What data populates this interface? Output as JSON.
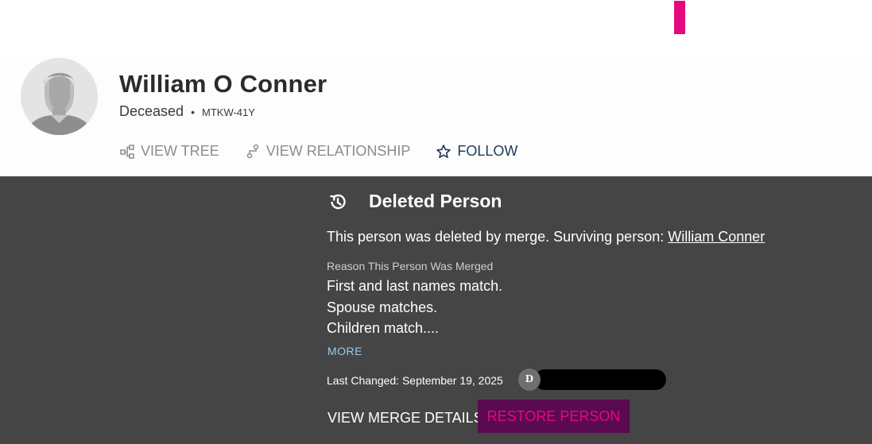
{
  "person": {
    "name": "William O Conner",
    "status": "Deceased",
    "separator": "•",
    "id": "MTKW-41Y"
  },
  "actions": {
    "view_tree": "VIEW TREE",
    "view_relationship": "VIEW RELATIONSHIP",
    "follow": "FOLLOW"
  },
  "deleted_panel": {
    "title": "Deleted Person",
    "merge_message": "This person was deleted by merge. Surviving person: ",
    "surviving_person": "William Conner",
    "reason_label": "Reason This Person Was Merged",
    "reason_lines": [
      "First and last names match.",
      "Spouse matches.",
      "Children match...."
    ],
    "more_label": "MORE",
    "last_changed": "Last Changed: September 19, 2025",
    "contributor_initial": "D",
    "view_merge_details": "VIEW MERGE DETAILS",
    "restore_person": "RESTORE PERSON"
  },
  "icons": {
    "view_tree": "tree-icon",
    "view_relationship": "relationship-icon",
    "follow": "star-outline-icon",
    "deleted": "history-icon",
    "avatar": "person-silhouette"
  },
  "colors": {
    "panel_background": "#454546",
    "accent_pink": "#e5097f",
    "restore_button_background": "#5a0a4f",
    "restore_button_text": "#e5097f",
    "link_blue": "#9ec9e6",
    "follow_blue": "#1f3a58"
  }
}
